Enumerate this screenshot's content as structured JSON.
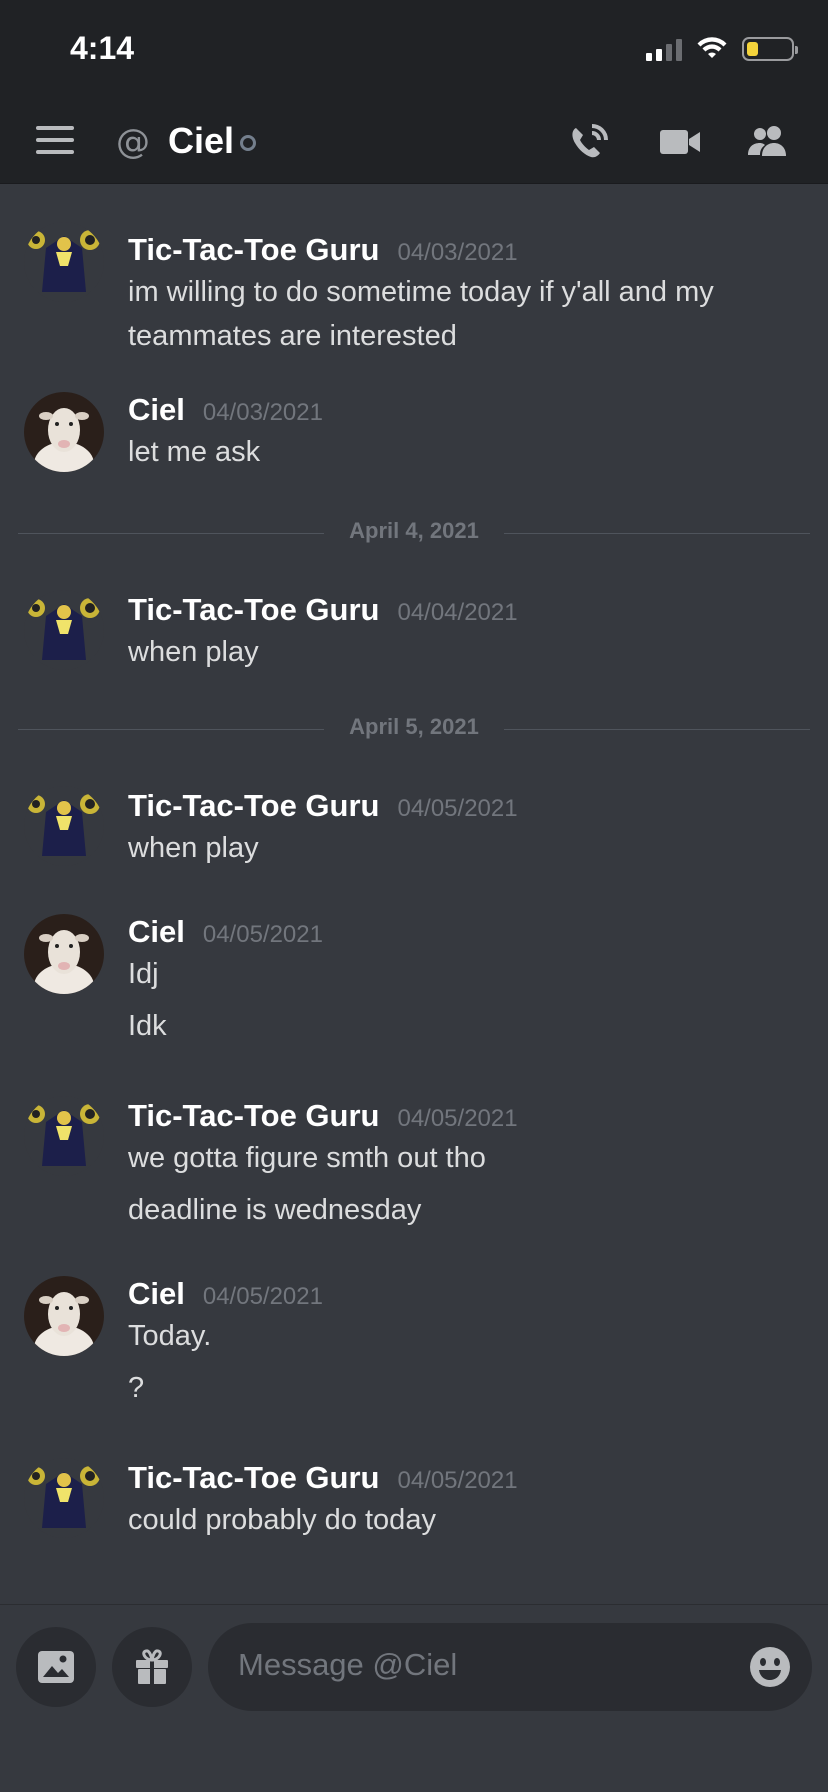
{
  "status_bar": {
    "time": "4:14"
  },
  "header": {
    "channel_name": "Ciel",
    "icons": [
      "menu-icon",
      "at-icon",
      "call-icon",
      "video-icon",
      "members-icon"
    ]
  },
  "dividers": [
    "April 4, 2021",
    "April 5, 2021"
  ],
  "messages": [
    {
      "author": "Tic-Tac-Toe Guru",
      "timestamp": "04/03/2021",
      "lines": [
        "im willing to do sometime today if y'all and my",
        "teammates are interested"
      ]
    },
    {
      "author": "Ciel",
      "timestamp": "04/03/2021",
      "lines": [
        "let me ask"
      ]
    },
    {
      "author": "Tic-Tac-Toe Guru",
      "timestamp": "04/04/2021",
      "lines": [
        "when play"
      ]
    },
    {
      "author": "Tic-Tac-Toe Guru",
      "timestamp": "04/05/2021",
      "lines": [
        "when play"
      ]
    },
    {
      "author": "Ciel",
      "timestamp": "04/05/2021",
      "lines": [
        "Idj",
        "Idk"
      ]
    },
    {
      "author": "Tic-Tac-Toe Guru",
      "timestamp": "04/05/2021",
      "lines": [
        "we gotta figure smth out tho",
        "deadline is wednesday"
      ]
    },
    {
      "author": "Ciel",
      "timestamp": "04/05/2021",
      "lines": [
        "Today.",
        "?"
      ]
    },
    {
      "author": "Tic-Tac-Toe Guru",
      "timestamp": "04/05/2021",
      "lines": [
        "could probably do today"
      ]
    }
  ],
  "composer": {
    "placeholder": "Message @Ciel",
    "icons": [
      "image-icon",
      "gift-icon",
      "emoji-icon"
    ]
  }
}
